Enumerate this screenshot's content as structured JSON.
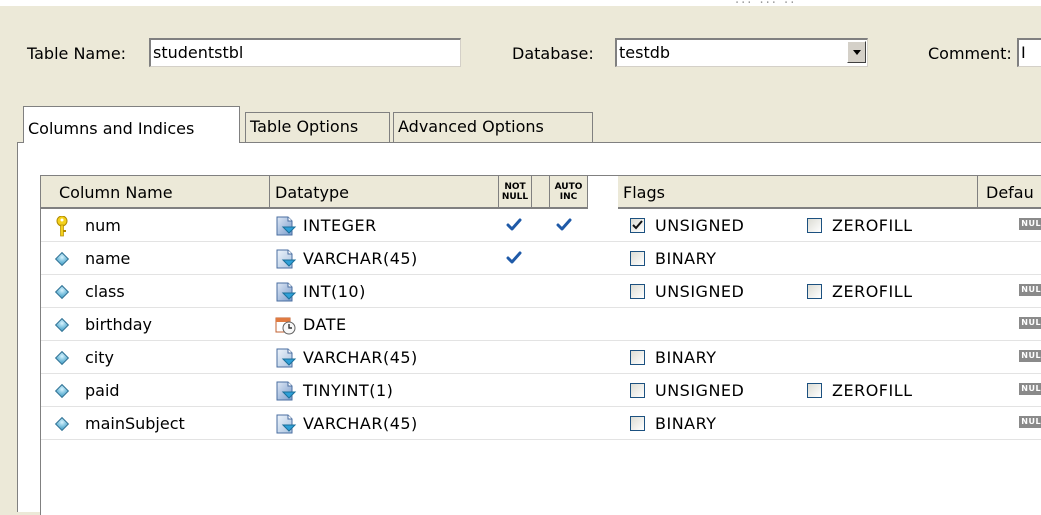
{
  "top_fragment": "... ... ..",
  "form": {
    "table_name_label": "Table Name:",
    "table_name_value": "studentstbl",
    "database_label": "Database:",
    "database_value": "testdb",
    "comment_label": "Comment:",
    "comment_value": "I"
  },
  "tabs": [
    {
      "label": "Columns and Indices",
      "active": true
    },
    {
      "label": "Table Options",
      "active": false
    },
    {
      "label": "Advanced Options",
      "active": false
    }
  ],
  "grid": {
    "headers": {
      "column_name": "Column Name",
      "datatype": "Datatype",
      "not_null_1": "NOT",
      "not_null_2": "NULL",
      "auto_inc_1": "AUTO",
      "auto_inc_2": "INC",
      "flags": "Flags",
      "default": "Defau"
    },
    "flag_labels": {
      "unsigned": "UNSIGNED",
      "zerofill": "ZEROFILL",
      "binary": "BINARY"
    },
    "null_badge": "NULL",
    "rows": [
      {
        "name": "num",
        "primary_key": true,
        "datatype": "INTEGER",
        "type_icon": "numeric",
        "not_null": true,
        "auto_inc": true,
        "flags": [
          "unsigned",
          "zerofill"
        ],
        "unsigned": true,
        "zerofill": false,
        "default_null": true
      },
      {
        "name": "name",
        "primary_key": false,
        "datatype": "VARCHAR(45)",
        "type_icon": "string",
        "not_null": true,
        "auto_inc": false,
        "flags": [
          "binary"
        ],
        "binary": false,
        "default_null": false
      },
      {
        "name": "class",
        "primary_key": false,
        "datatype": "INT(10)",
        "type_icon": "numeric",
        "not_null": false,
        "auto_inc": false,
        "flags": [
          "unsigned",
          "zerofill"
        ],
        "unsigned": false,
        "zerofill": false,
        "default_null": true
      },
      {
        "name": "birthday",
        "primary_key": false,
        "datatype": "DATE",
        "type_icon": "date",
        "not_null": false,
        "auto_inc": false,
        "flags": [],
        "default_null": true
      },
      {
        "name": "city",
        "primary_key": false,
        "datatype": "VARCHAR(45)",
        "type_icon": "string",
        "not_null": false,
        "auto_inc": false,
        "flags": [
          "binary"
        ],
        "binary": false,
        "default_null": true
      },
      {
        "name": "paid",
        "primary_key": false,
        "datatype": "TINYINT(1)",
        "type_icon": "numeric",
        "not_null": false,
        "auto_inc": false,
        "flags": [
          "unsigned",
          "zerofill"
        ],
        "unsigned": false,
        "zerofill": false,
        "default_null": true
      },
      {
        "name": "mainSubject",
        "primary_key": false,
        "datatype": "VARCHAR(45)",
        "type_icon": "string",
        "not_null": false,
        "auto_inc": false,
        "flags": [
          "binary"
        ],
        "binary": false,
        "default_null": true
      }
    ]
  },
  "colors": {
    "window_bg": "#ece9d8",
    "check_blue": "#1f5aa8",
    "key_yellow": "#f4d11c"
  }
}
